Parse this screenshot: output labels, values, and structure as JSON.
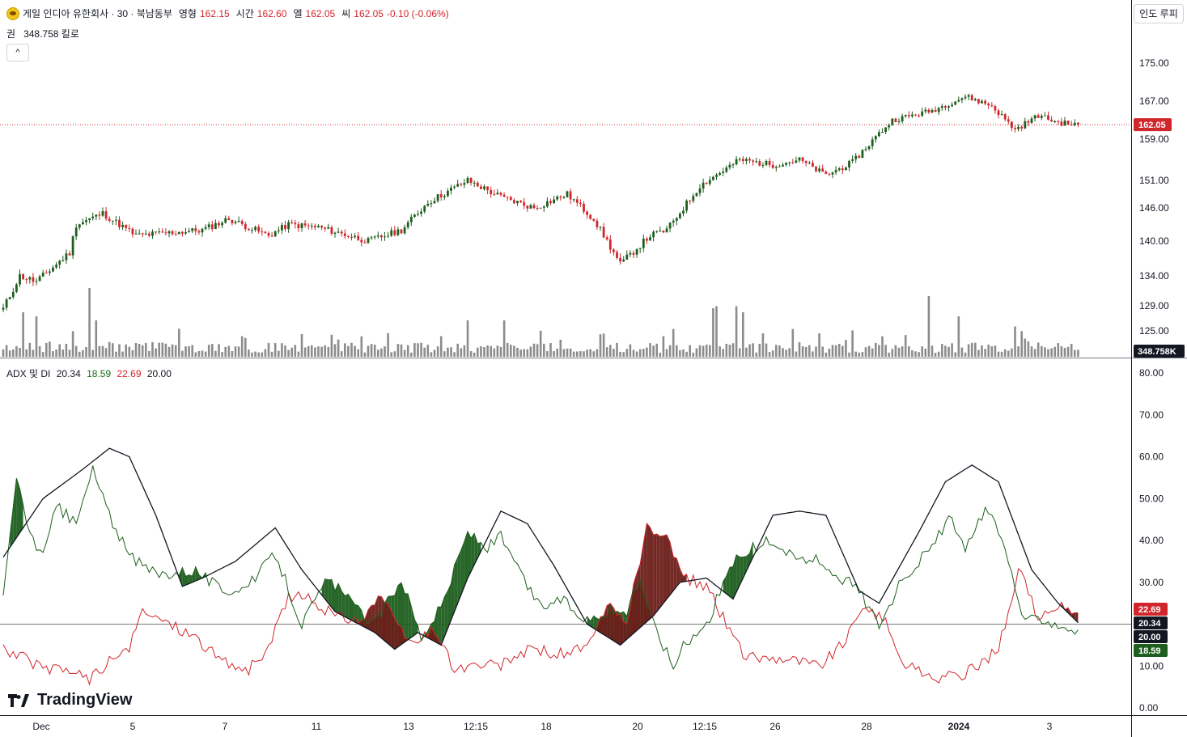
{
  "header": {
    "symbol_title": "게일 인디아 유한회사 · 30 · 북남동부",
    "open_label": "영형",
    "open": "162.15",
    "high_label": "시간",
    "high": "162.60",
    "low_label": "엘",
    "low": "162.05",
    "close_label": "씨",
    "close": "162.05",
    "change": "-0.10 (-0.06%)"
  },
  "volume_legend": {
    "label": "권",
    "value": "348.758 킬로"
  },
  "collapse_button": "^",
  "currency_button": "인도 루피",
  "indicator_legend": {
    "name": "ADX 및 DI",
    "adx": "20.34",
    "plus_di": "18.59",
    "minus_di": "22.69",
    "threshold": "20.00"
  },
  "branding": {
    "text": "TradingView"
  },
  "colors": {
    "up": "#1e5e1e",
    "down": "#d1262c",
    "volume": "#8c8c8c",
    "adx": "#131722",
    "plus_di": "#1e5e1e",
    "minus_di": "#d1262c",
    "threshold": "#777777"
  },
  "chart_data": [
    {
      "type": "candlestick",
      "price_axis_ticks": [
        "175.00",
        "167.00",
        "159.00",
        "151.00",
        "146.00",
        "140.00",
        "134.00",
        "129.00",
        "125.00"
      ],
      "last_price_label": "162.05",
      "volume_label": "348.758K",
      "x_tick_labels": [
        "Dec",
        "5",
        "7",
        "11",
        "13",
        "12:15",
        "18",
        "20",
        "12:15",
        "26",
        "28",
        "2024",
        "3"
      ],
      "price_anchors": [
        {
          "bar": 0,
          "v": 128.5
        },
        {
          "bar": 5,
          "v": 134
        },
        {
          "bar": 10,
          "v": 133
        },
        {
          "bar": 20,
          "v": 138
        },
        {
          "bar": 22,
          "v": 143
        },
        {
          "bar": 30,
          "v": 145
        },
        {
          "bar": 40,
          "v": 141
        },
        {
          "bar": 60,
          "v": 142
        },
        {
          "bar": 68,
          "v": 144
        },
        {
          "bar": 80,
          "v": 141
        },
        {
          "bar": 86,
          "v": 143
        },
        {
          "bar": 95,
          "v": 142.5
        },
        {
          "bar": 110,
          "v": 140
        },
        {
          "bar": 120,
          "v": 142
        },
        {
          "bar": 128,
          "v": 147
        },
        {
          "bar": 140,
          "v": 151
        },
        {
          "bar": 150,
          "v": 148
        },
        {
          "bar": 160,
          "v": 146
        },
        {
          "bar": 170,
          "v": 148.5
        },
        {
          "bar": 178,
          "v": 144
        },
        {
          "bar": 186,
          "v": 136
        },
        {
          "bar": 195,
          "v": 141
        },
        {
          "bar": 200,
          "v": 142
        },
        {
          "bar": 210,
          "v": 150
        },
        {
          "bar": 222,
          "v": 155
        },
        {
          "bar": 232,
          "v": 154
        },
        {
          "bar": 240,
          "v": 155
        },
        {
          "bar": 248,
          "v": 152
        },
        {
          "bar": 256,
          "v": 154.5
        },
        {
          "bar": 268,
          "v": 163
        },
        {
          "bar": 280,
          "v": 165
        },
        {
          "bar": 290,
          "v": 168
        },
        {
          "bar": 298,
          "v": 166
        },
        {
          "bar": 305,
          "v": 161
        },
        {
          "bar": 312,
          "v": 164
        },
        {
          "bar": 318,
          "v": 162.5
        },
        {
          "bar": 324,
          "v": 162.05
        }
      ],
      "volume_spikes": [
        {
          "bar": 6,
          "v": 22
        },
        {
          "bar": 10,
          "v": 20
        },
        {
          "bar": 26,
          "v": 34
        },
        {
          "bar": 28,
          "v": 18
        },
        {
          "bar": 140,
          "v": 18
        },
        {
          "bar": 151,
          "v": 18
        },
        {
          "bar": 214,
          "v": 24
        },
        {
          "bar": 215,
          "v": 25
        },
        {
          "bar": 221,
          "v": 25
        },
        {
          "bar": 223,
          "v": 22
        },
        {
          "bar": 279,
          "v": 30
        },
        {
          "bar": 288,
          "v": 20
        },
        {
          "bar": 305,
          "v": 15
        }
      ]
    },
    {
      "type": "line",
      "title": "ADX 및 DI",
      "y_axis_ticks": [
        "80.00",
        "70.00",
        "60.00",
        "50.00",
        "40.00",
        "30.00",
        "20.00",
        "10.00",
        "0.00"
      ],
      "ylim": [
        0,
        80
      ],
      "threshold": 20,
      "last_values": {
        "minus_di": "22.69",
        "adx": "20.34",
        "threshold": "20.00",
        "plus_di": "18.59"
      },
      "series": [
        {
          "key": "adx",
          "anchors": [
            {
              "bar": 0,
              "v": 36
            },
            {
              "bar": 12,
              "v": 50
            },
            {
              "bar": 24,
              "v": 57
            },
            {
              "bar": 32,
              "v": 62
            },
            {
              "bar": 38,
              "v": 60
            },
            {
              "bar": 46,
              "v": 46
            },
            {
              "bar": 54,
              "v": 29
            },
            {
              "bar": 60,
              "v": 31
            },
            {
              "bar": 70,
              "v": 35
            },
            {
              "bar": 82,
              "v": 43
            },
            {
              "bar": 90,
              "v": 33
            },
            {
              "bar": 100,
              "v": 23
            },
            {
              "bar": 112,
              "v": 18
            },
            {
              "bar": 118,
              "v": 14
            },
            {
              "bar": 125,
              "v": 18
            },
            {
              "bar": 132,
              "v": 15
            },
            {
              "bar": 140,
              "v": 31
            },
            {
              "bar": 150,
              "v": 47
            },
            {
              "bar": 158,
              "v": 44
            },
            {
              "bar": 166,
              "v": 34
            },
            {
              "bar": 176,
              "v": 20
            },
            {
              "bar": 186,
              "v": 15
            },
            {
              "bar": 196,
              "v": 22
            },
            {
              "bar": 204,
              "v": 30
            },
            {
              "bar": 212,
              "v": 31
            },
            {
              "bar": 220,
              "v": 26
            },
            {
              "bar": 232,
              "v": 46
            },
            {
              "bar": 240,
              "v": 47
            },
            {
              "bar": 248,
              "v": 46
            },
            {
              "bar": 258,
              "v": 28
            },
            {
              "bar": 264,
              "v": 25
            },
            {
              "bar": 276,
              "v": 42
            },
            {
              "bar": 284,
              "v": 54
            },
            {
              "bar": 292,
              "v": 58
            },
            {
              "bar": 300,
              "v": 54
            },
            {
              "bar": 310,
              "v": 33
            },
            {
              "bar": 318,
              "v": 25
            },
            {
              "bar": 324,
              "v": 20.34
            }
          ]
        },
        {
          "key": "plus_di",
          "anchors": [
            {
              "bar": 0,
              "v": 28
            },
            {
              "bar": 4,
              "v": 54
            },
            {
              "bar": 8,
              "v": 42
            },
            {
              "bar": 12,
              "v": 36
            },
            {
              "bar": 16,
              "v": 48
            },
            {
              "bar": 22,
              "v": 44
            },
            {
              "bar": 27,
              "v": 57
            },
            {
              "bar": 32,
              "v": 46
            },
            {
              "bar": 38,
              "v": 36
            },
            {
              "bar": 46,
              "v": 32
            },
            {
              "bar": 58,
              "v": 33
            },
            {
              "bar": 66,
              "v": 28
            },
            {
              "bar": 74,
              "v": 29
            },
            {
              "bar": 82,
              "v": 37
            },
            {
              "bar": 90,
              "v": 20
            },
            {
              "bar": 98,
              "v": 31
            },
            {
              "bar": 106,
              "v": 24
            },
            {
              "bar": 112,
              "v": 20
            },
            {
              "bar": 120,
              "v": 31
            },
            {
              "bar": 126,
              "v": 17
            },
            {
              "bar": 132,
              "v": 24
            },
            {
              "bar": 140,
              "v": 42
            },
            {
              "bar": 146,
              "v": 38
            },
            {
              "bar": 150,
              "v": 41
            },
            {
              "bar": 155,
              "v": 33
            },
            {
              "bar": 162,
              "v": 24
            },
            {
              "bar": 168,
              "v": 26
            },
            {
              "bar": 176,
              "v": 21
            },
            {
              "bar": 182,
              "v": 23
            },
            {
              "bar": 188,
              "v": 23
            },
            {
              "bar": 192,
              "v": 31
            },
            {
              "bar": 196,
              "v": 20
            },
            {
              "bar": 202,
              "v": 10
            },
            {
              "bar": 206,
              "v": 16
            },
            {
              "bar": 212,
              "v": 20
            },
            {
              "bar": 220,
              "v": 35
            },
            {
              "bar": 226,
              "v": 38
            },
            {
              "bar": 232,
              "v": 40
            },
            {
              "bar": 238,
              "v": 36
            },
            {
              "bar": 246,
              "v": 35
            },
            {
              "bar": 258,
              "v": 28
            },
            {
              "bar": 264,
              "v": 20
            },
            {
              "bar": 272,
              "v": 32
            },
            {
              "bar": 280,
              "v": 38
            },
            {
              "bar": 285,
              "v": 46
            },
            {
              "bar": 290,
              "v": 37
            },
            {
              "bar": 296,
              "v": 48
            },
            {
              "bar": 302,
              "v": 38
            },
            {
              "bar": 308,
              "v": 20
            },
            {
              "bar": 312,
              "v": 22
            },
            {
              "bar": 318,
              "v": 20
            },
            {
              "bar": 324,
              "v": 18.59
            }
          ]
        },
        {
          "key": "minus_di",
          "anchors": [
            {
              "bar": 0,
              "v": 14
            },
            {
              "bar": 6,
              "v": 12
            },
            {
              "bar": 12,
              "v": 9
            },
            {
              "bar": 20,
              "v": 9
            },
            {
              "bar": 26,
              "v": 7
            },
            {
              "bar": 32,
              "v": 11
            },
            {
              "bar": 38,
              "v": 14
            },
            {
              "bar": 42,
              "v": 23
            },
            {
              "bar": 48,
              "v": 21
            },
            {
              "bar": 58,
              "v": 17
            },
            {
              "bar": 66,
              "v": 11
            },
            {
              "bar": 74,
              "v": 9
            },
            {
              "bar": 80,
              "v": 14
            },
            {
              "bar": 86,
              "v": 27
            },
            {
              "bar": 92,
              "v": 26
            },
            {
              "bar": 100,
              "v": 22
            },
            {
              "bar": 108,
              "v": 21
            },
            {
              "bar": 114,
              "v": 27
            },
            {
              "bar": 118,
              "v": 20
            },
            {
              "bar": 124,
              "v": 15
            },
            {
              "bar": 130,
              "v": 19
            },
            {
              "bar": 136,
              "v": 9
            },
            {
              "bar": 142,
              "v": 10
            },
            {
              "bar": 150,
              "v": 10
            },
            {
              "bar": 158,
              "v": 14
            },
            {
              "bar": 168,
              "v": 13
            },
            {
              "bar": 176,
              "v": 14
            },
            {
              "bar": 182,
              "v": 24
            },
            {
              "bar": 188,
              "v": 21
            },
            {
              "bar": 194,
              "v": 43
            },
            {
              "bar": 200,
              "v": 40
            },
            {
              "bar": 206,
              "v": 31
            },
            {
              "bar": 212,
              "v": 29
            },
            {
              "bar": 218,
              "v": 20
            },
            {
              "bar": 224,
              "v": 12
            },
            {
              "bar": 236,
              "v": 12
            },
            {
              "bar": 246,
              "v": 10
            },
            {
              "bar": 254,
              "v": 16
            },
            {
              "bar": 260,
              "v": 25
            },
            {
              "bar": 266,
              "v": 20
            },
            {
              "bar": 272,
              "v": 10
            },
            {
              "bar": 282,
              "v": 7
            },
            {
              "bar": 290,
              "v": 8
            },
            {
              "bar": 300,
              "v": 14
            },
            {
              "bar": 306,
              "v": 33
            },
            {
              "bar": 312,
              "v": 22
            },
            {
              "bar": 318,
              "v": 24
            },
            {
              "bar": 324,
              "v": 22.69
            }
          ]
        }
      ]
    }
  ]
}
